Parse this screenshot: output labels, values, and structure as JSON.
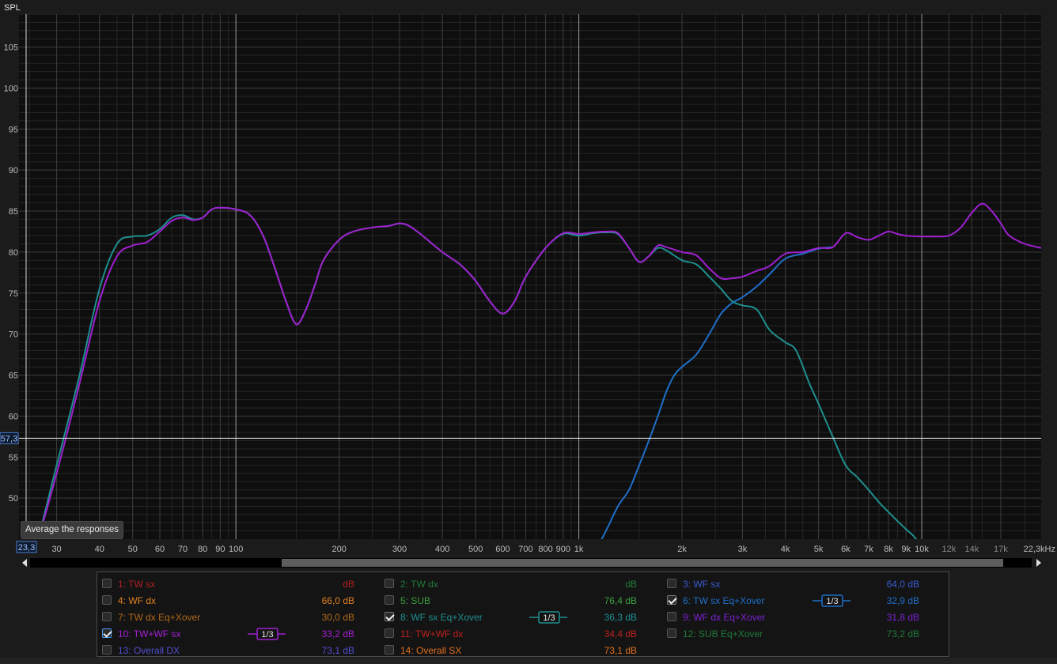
{
  "chart_data": {
    "type": "line",
    "title": "",
    "ylabel": "SPL",
    "xlabel": "",
    "x_unit": "kHz",
    "x_scale": "log",
    "xlim": [
      23.3,
      22300
    ],
    "ylim": [
      45,
      109
    ],
    "grid": true,
    "y_ticks": [
      50,
      55,
      60,
      65,
      70,
      75,
      80,
      85,
      90,
      95,
      100,
      105
    ],
    "y_tick_labels": [
      "50",
      "55",
      "60",
      "65",
      "70",
      "75",
      "80",
      "85",
      "90",
      "95",
      "100",
      "105"
    ],
    "x_ticks": [
      {
        "v": 30,
        "label": "30"
      },
      {
        "v": 40,
        "label": "40"
      },
      {
        "v": 50,
        "label": "50"
      },
      {
        "v": 60,
        "label": "60"
      },
      {
        "v": 70,
        "label": "70"
      },
      {
        "v": 80,
        "label": "80"
      },
      {
        "v": 90,
        "label": "90"
      },
      {
        "v": 100,
        "label": "100"
      },
      {
        "v": 200,
        "label": "200"
      },
      {
        "v": 300,
        "label": "300"
      },
      {
        "v": 400,
        "label": "400"
      },
      {
        "v": 500,
        "label": "500"
      },
      {
        "v": 600,
        "label": "600"
      },
      {
        "v": 700,
        "label": "700"
      },
      {
        "v": 800,
        "label": "800"
      },
      {
        "v": 900,
        "label": "900"
      },
      {
        "v": 1000,
        "label": "1k"
      },
      {
        "v": 2000,
        "label": "2k"
      },
      {
        "v": 3000,
        "label": "3k"
      },
      {
        "v": 4000,
        "label": "4k"
      },
      {
        "v": 5000,
        "label": "5k"
      },
      {
        "v": 6000,
        "label": "6k"
      },
      {
        "v": 7000,
        "label": "7k"
      },
      {
        "v": 8000,
        "label": "8k"
      },
      {
        "v": 9000,
        "label": "9k"
      },
      {
        "v": 10000,
        "label": "10k"
      },
      {
        "v": 12000,
        "label": "12k",
        "dim": true
      },
      {
        "v": 14000,
        "label": "14k",
        "dim": true
      },
      {
        "v": 17000,
        "label": "17k",
        "dim": true
      },
      {
        "v": 22300,
        "label": "22,3kHz"
      }
    ],
    "cursor": {
      "x_label": "23,3",
      "y": 57.3,
      "y_label": "57,3"
    },
    "series": [
      {
        "name": "10: TW+WF sx",
        "color": "#a020d0",
        "points": [
          [
            23.3,
            40
          ],
          [
            26,
            44
          ],
          [
            30,
            53
          ],
          [
            35,
            64
          ],
          [
            40,
            74
          ],
          [
            45,
            79.5
          ],
          [
            50,
            80.8
          ],
          [
            55,
            81.2
          ],
          [
            60,
            82.5
          ],
          [
            65,
            83.8
          ],
          [
            70,
            84.2
          ],
          [
            75,
            83.9
          ],
          [
            80,
            84.2
          ],
          [
            85,
            85.2
          ],
          [
            90,
            85.4
          ],
          [
            100,
            85.2
          ],
          [
            110,
            84.5
          ],
          [
            120,
            82
          ],
          [
            130,
            78
          ],
          [
            140,
            74
          ],
          [
            150,
            71.2
          ],
          [
            160,
            73
          ],
          [
            170,
            76
          ],
          [
            180,
            79
          ],
          [
            200,
            81.5
          ],
          [
            220,
            82.5
          ],
          [
            250,
            83
          ],
          [
            280,
            83.2
          ],
          [
            300,
            83.5
          ],
          [
            320,
            83.2
          ],
          [
            350,
            82
          ],
          [
            400,
            80
          ],
          [
            450,
            78.5
          ],
          [
            500,
            76.5
          ],
          [
            550,
            74
          ],
          [
            600,
            72.5
          ],
          [
            650,
            74
          ],
          [
            700,
            77
          ],
          [
            800,
            80.5
          ],
          [
            900,
            82.3
          ],
          [
            1000,
            82.2
          ],
          [
            1100,
            82.4
          ],
          [
            1200,
            82.5
          ],
          [
            1300,
            82.3
          ],
          [
            1400,
            80.5
          ],
          [
            1500,
            78.8
          ],
          [
            1600,
            79.5
          ],
          [
            1700,
            80.8
          ],
          [
            1800,
            80.6
          ],
          [
            2000,
            80
          ],
          [
            2200,
            79.6
          ],
          [
            2400,
            78
          ],
          [
            2600,
            76.8
          ],
          [
            2800,
            76.8
          ],
          [
            3000,
            77
          ],
          [
            3300,
            77.7
          ],
          [
            3600,
            78.3
          ],
          [
            4000,
            79.8
          ],
          [
            4500,
            80
          ],
          [
            5000,
            80.5
          ],
          [
            5500,
            80.6
          ],
          [
            6000,
            82.3
          ],
          [
            6500,
            81.8
          ],
          [
            7000,
            81.5
          ],
          [
            7500,
            82
          ],
          [
            8000,
            82.5
          ],
          [
            8500,
            82.2
          ],
          [
            9000,
            82
          ],
          [
            10000,
            81.9
          ],
          [
            11000,
            81.9
          ],
          [
            12000,
            82
          ],
          [
            13000,
            83
          ],
          [
            14000,
            84.8
          ],
          [
            15000,
            85.9
          ],
          [
            16000,
            85
          ],
          [
            17000,
            83.5
          ],
          [
            18000,
            82
          ],
          [
            20000,
            81
          ],
          [
            22300,
            80.5
          ]
        ]
      },
      {
        "name": "8: WF sx Eq+Xover",
        "color": "#1f8f8f",
        "points": [
          [
            23.3,
            40
          ],
          [
            26,
            44
          ],
          [
            30,
            54
          ],
          [
            35,
            65
          ],
          [
            40,
            75.5
          ],
          [
            45,
            81
          ],
          [
            50,
            81.9
          ],
          [
            55,
            82
          ],
          [
            60,
            82.8
          ],
          [
            65,
            84.2
          ],
          [
            70,
            84.5
          ],
          [
            75,
            84
          ],
          [
            80,
            84.2
          ],
          [
            85,
            85.2
          ],
          [
            90,
            85.4
          ],
          [
            100,
            85.2
          ],
          [
            110,
            84.5
          ],
          [
            120,
            82
          ],
          [
            130,
            78
          ],
          [
            140,
            74
          ],
          [
            150,
            71.2
          ],
          [
            160,
            73
          ],
          [
            170,
            76
          ],
          [
            180,
            79
          ],
          [
            200,
            81.5
          ],
          [
            220,
            82.5
          ],
          [
            250,
            83
          ],
          [
            280,
            83.2
          ],
          [
            300,
            83.5
          ],
          [
            320,
            83.2
          ],
          [
            350,
            82
          ],
          [
            400,
            80
          ],
          [
            450,
            78.5
          ],
          [
            500,
            76.5
          ],
          [
            550,
            74
          ],
          [
            600,
            72.5
          ],
          [
            650,
            74
          ],
          [
            700,
            77
          ],
          [
            800,
            80.5
          ],
          [
            900,
            82.2
          ],
          [
            1000,
            82
          ],
          [
            1100,
            82.3
          ],
          [
            1200,
            82.4
          ],
          [
            1300,
            82.2
          ],
          [
            1400,
            80.5
          ],
          [
            1500,
            78.8
          ],
          [
            1600,
            79.5
          ],
          [
            1700,
            80.5
          ],
          [
            1800,
            80.2
          ],
          [
            2000,
            79
          ],
          [
            2200,
            78.5
          ],
          [
            2400,
            77
          ],
          [
            2600,
            75.5
          ],
          [
            2800,
            74
          ],
          [
            3000,
            73.5
          ],
          [
            3300,
            73
          ],
          [
            3600,
            70.5
          ],
          [
            4000,
            69
          ],
          [
            4300,
            68
          ],
          [
            4700,
            64
          ],
          [
            5000,
            61.5
          ],
          [
            5500,
            57.5
          ],
          [
            6000,
            54
          ],
          [
            6500,
            52.5
          ],
          [
            7000,
            51
          ],
          [
            7500,
            49.5
          ],
          [
            8000,
            48.3
          ],
          [
            8500,
            47.2
          ],
          [
            9000,
            46.2
          ],
          [
            9500,
            45.3
          ],
          [
            10000,
            44
          ]
        ]
      },
      {
        "name": "6: TW sx Eq+Xover",
        "color": "#1f6fc8",
        "points": [
          [
            1100,
            43
          ],
          [
            1200,
            46
          ],
          [
            1300,
            49
          ],
          [
            1400,
            51
          ],
          [
            1500,
            54
          ],
          [
            1600,
            57
          ],
          [
            1700,
            60
          ],
          [
            1800,
            63
          ],
          [
            1900,
            65
          ],
          [
            2000,
            66
          ],
          [
            2200,
            67.5
          ],
          [
            2400,
            70
          ],
          [
            2600,
            72.5
          ],
          [
            2800,
            73.8
          ],
          [
            3000,
            74.5
          ],
          [
            3300,
            75.8
          ],
          [
            3600,
            77.3
          ],
          [
            4000,
            79.2
          ],
          [
            4500,
            79.8
          ],
          [
            5000,
            80.4
          ],
          [
            5500,
            80.6
          ]
        ]
      }
    ]
  },
  "tooltip": "Average the responses",
  "legend": {
    "items": [
      {
        "name": "1: TW sx",
        "value": "dB",
        "color": "#b02020",
        "checked": false,
        "col": 0,
        "row": 0
      },
      {
        "name": "4: WF dx",
        "value": "66,0 dB",
        "color": "#e08020",
        "checked": false,
        "col": 0,
        "row": 1
      },
      {
        "name": "7: TW dx Eq+Xover",
        "value": "30,0 dB",
        "color": "#b06818",
        "checked": false,
        "col": 0,
        "row": 2
      },
      {
        "name": "10: TW+WF sx",
        "value": "33,2 dB",
        "color": "#a020d0",
        "checked": true,
        "selected": true,
        "smooth": true,
        "col": 0,
        "row": 3
      },
      {
        "name": "13: Overall DX",
        "value": "73,1 dB",
        "color": "#5050d0",
        "checked": false,
        "col": 0,
        "row": 4
      },
      {
        "name": "2: TW dx",
        "value": "dB",
        "color": "#207a3a",
        "checked": false,
        "col": 1,
        "row": 0
      },
      {
        "name": "5: SUB",
        "value": "76,4 dB",
        "color": "#3aa040",
        "checked": false,
        "col": 1,
        "row": 1
      },
      {
        "name": "8: WF sx Eq+Xover",
        "value": "36,3 dB",
        "color": "#1f8f8f",
        "checked": true,
        "smooth": true,
        "col": 1,
        "row": 2
      },
      {
        "name": "11: TW+WF dx",
        "value": "34,4 dB",
        "color": "#c02020",
        "checked": false,
        "col": 1,
        "row": 3
      },
      {
        "name": "14: Overall SX",
        "value": "73,1 dB",
        "color": "#e07020",
        "checked": false,
        "col": 1,
        "row": 4
      },
      {
        "name": "3: WF sx",
        "value": "64,0 dB",
        "color": "#3a5ad0",
        "checked": false,
        "col": 2,
        "row": 0
      },
      {
        "name": "6: TW sx Eq+Xover",
        "value": "32,9 dB",
        "color": "#1f6fc8",
        "checked": true,
        "smooth": true,
        "col": 2,
        "row": 1
      },
      {
        "name": "9: WF dx Eq+Xover",
        "value": "31,8 dB",
        "color": "#7a20d0",
        "checked": false,
        "col": 2,
        "row": 2
      },
      {
        "name": "12: SUB Eq+Xover",
        "value": "73,2 dB",
        "color": "#207a3a",
        "checked": false,
        "col": 2,
        "row": 3
      }
    ],
    "smooth_label": "1/3"
  }
}
